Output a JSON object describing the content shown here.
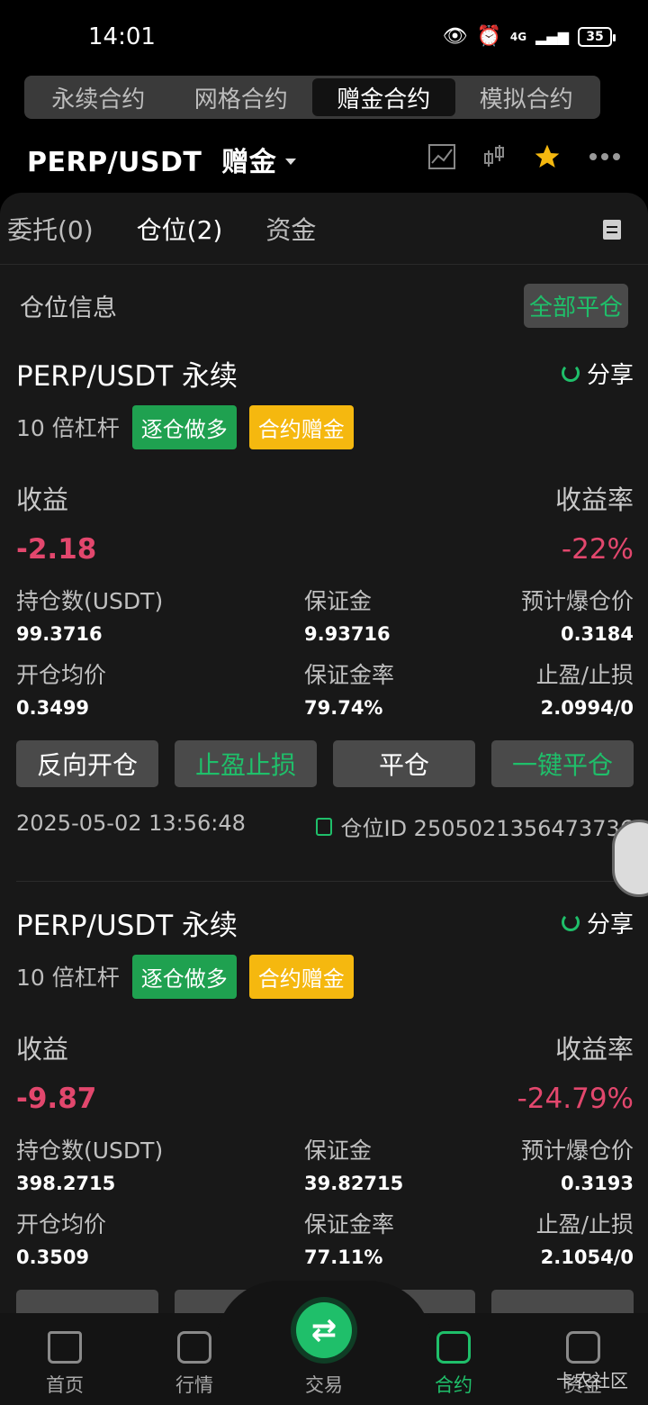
{
  "status": {
    "time": "14:01",
    "battery": "35",
    "network": "4G"
  },
  "mode_tabs": [
    {
      "label": "永续合约"
    },
    {
      "label": "网格合约"
    },
    {
      "label": "赠金合约"
    },
    {
      "label": "模拟合约"
    }
  ],
  "pair": {
    "title": "PERP/USDT  赠金"
  },
  "sub_tabs": [
    {
      "label": "委托(0)"
    },
    {
      "label": "仓位(2)"
    },
    {
      "label": "资金"
    }
  ],
  "info": {
    "title": "仓位信息",
    "close_all": "全部平仓"
  },
  "positions": [
    {
      "name": "PERP/USDT 永续",
      "share": "分享",
      "leverage": "10 倍杠杆",
      "mode_tag": "逐仓做多",
      "bonus_tag": "合约赠金",
      "pnl_label": "收益",
      "pnl_rate_label": "收益率",
      "pnl": "-2.18",
      "pnl_rate": "-22%",
      "size_label": "持仓数(USDT)",
      "size": "99.3716",
      "margin_label": "保证金",
      "margin": "9.93716",
      "liq_label": "预计爆仓价",
      "liq": "0.3184",
      "entry_label": "开仓均价",
      "entry": "0.3499",
      "margin_rate_label": "保证金率",
      "margin_rate": "79.74%",
      "tpsl_label": "止盈/止损",
      "tpsl": "2.0994/0",
      "btn_reverse": "反向开仓",
      "btn_tpsl": "止盈止损",
      "btn_close": "平仓",
      "btn_quick_close": "一键平仓",
      "time": "2025-05-02 13:56:48",
      "pos_id": "仓位ID 2505021356473736"
    },
    {
      "name": "PERP/USDT 永续",
      "share": "分享",
      "leverage": "10 倍杠杆",
      "mode_tag": "逐仓做多",
      "bonus_tag": "合约赠金",
      "pnl_label": "收益",
      "pnl_rate_label": "收益率",
      "pnl": "-9.87",
      "pnl_rate": "-24.79%",
      "size_label": "持仓数(USDT)",
      "size": "398.2715",
      "margin_label": "保证金",
      "margin": "39.82715",
      "liq_label": "预计爆仓价",
      "liq": "0.3193",
      "entry_label": "开仓均价",
      "entry": "0.3509",
      "margin_rate_label": "保证金率",
      "margin_rate": "77.11%",
      "tpsl_label": "止盈/止损",
      "tpsl": "2.1054/0"
    }
  ],
  "bottom_nav": [
    {
      "label": "首页",
      "icon": "home-icon"
    },
    {
      "label": "行情",
      "icon": "market-icon"
    },
    {
      "label": "交易",
      "icon": "swap-icon"
    },
    {
      "label": "合约",
      "icon": "contract-icon"
    },
    {
      "label": "资金",
      "icon": "wallet-icon"
    }
  ],
  "watermark": "卡农社区",
  "colors": {
    "green": "#1fbf6a",
    "red": "#e2476d",
    "yellow": "#f5b80f"
  }
}
